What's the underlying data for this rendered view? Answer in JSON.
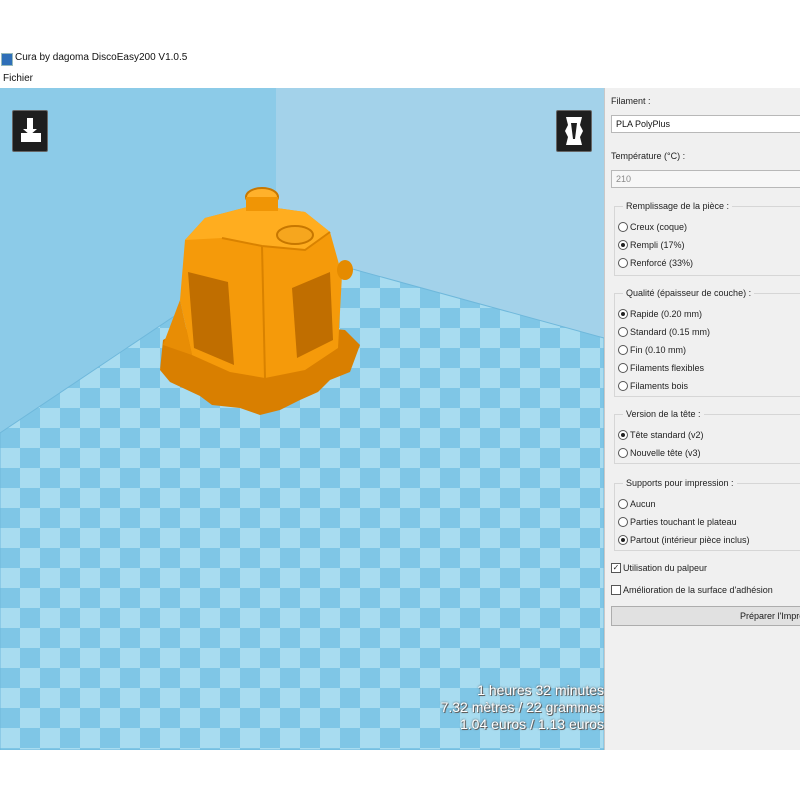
{
  "window": {
    "title": "Cura by dagoma DiscoEasy200 V1.0.5"
  },
  "menu": {
    "file": "Fichier"
  },
  "viewport": {
    "stats": [
      "1 heures 32 minutes",
      "7.32 mètres / 22 grammes",
      "1.04 euros / 1.13 euros"
    ],
    "colors": {
      "floor": "#7fc6e6",
      "tile_light": "#a8dcf0",
      "wall_left": "#8ccbe8",
      "wall_back": "#a3d2ea",
      "model": "#f59a0a"
    }
  },
  "panel": {
    "filament_label": "Filament :",
    "filament_value": "PLA PolyPlus",
    "temperature_label": "Température (°C) :",
    "temperature_value": "210",
    "infill": {
      "title": "Remplissage de la pièce :",
      "options": [
        {
          "label": "Creux (coque)",
          "selected": false
        },
        {
          "label": "Rempli (17%)",
          "selected": true
        },
        {
          "label": "Renforcé (33%)",
          "selected": false
        }
      ]
    },
    "quality": {
      "title": "Qualité (épaisseur de couche) :",
      "options": [
        {
          "label": "Rapide (0.20 mm)",
          "selected": true
        },
        {
          "label": "Standard (0.15 mm)",
          "selected": false
        },
        {
          "label": "Fin (0.10 mm)",
          "selected": false
        },
        {
          "label": "Filaments flexibles",
          "selected": false
        },
        {
          "label": "Filaments bois",
          "selected": false
        }
      ]
    },
    "head": {
      "title": "Version de la tête :",
      "options": [
        {
          "label": "Tête standard (v2)",
          "selected": true
        },
        {
          "label": "Nouvelle tête (v3)",
          "selected": false
        }
      ]
    },
    "supports": {
      "title": "Supports pour impression :",
      "options": [
        {
          "label": "Aucun",
          "selected": false
        },
        {
          "label": "Parties touchant le plateau",
          "selected": false
        },
        {
          "label": "Partout (intérieur pièce inclus)",
          "selected": true
        }
      ]
    },
    "probe": {
      "label": "Utilisation du palpeur",
      "checked": true
    },
    "adhesion": {
      "label": "Amélioration de la surface d'adhésion",
      "checked": false
    },
    "prepare_button": "Préparer l'Impression"
  }
}
